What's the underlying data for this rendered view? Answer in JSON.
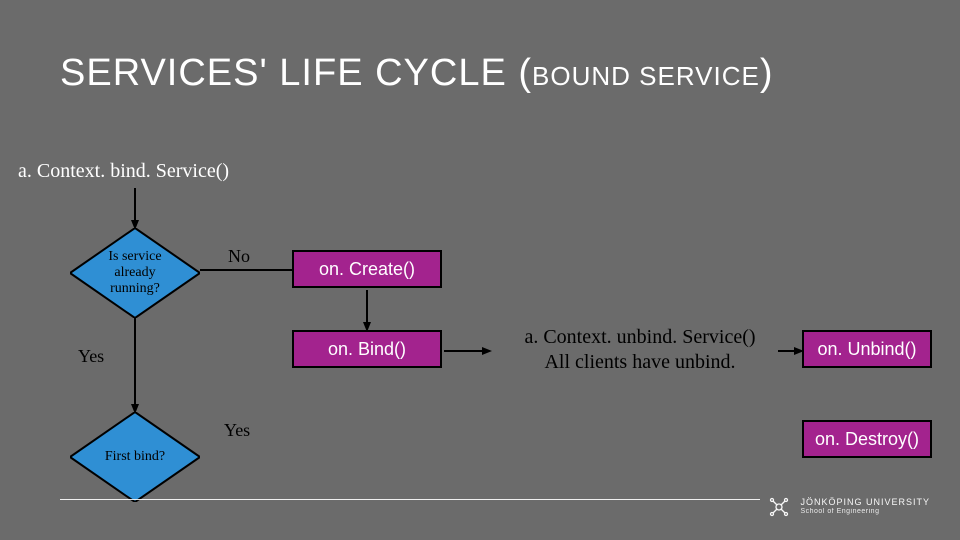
{
  "title_main": "SERVICES' LIFE CYCLE ",
  "title_paren_open": "(",
  "title_sub": "BOUND SERVICE",
  "title_paren_close": ")",
  "entry_call": "a. Context. bind. Service()",
  "decision1": "Is service already running?",
  "decision2": "First bind?",
  "labels": {
    "no": "No",
    "yes1": "Yes",
    "yes2": "Yes"
  },
  "procs": {
    "onCreate": "on. Create()",
    "onBind": "on. Bind()",
    "onUnbind": "on. Unbind()",
    "onDestroy": "on. Destroy()"
  },
  "midtext_line1": "a. Context. unbind. Service()",
  "midtext_line2": "All clients have unbind.",
  "logo": {
    "name": "JÖNKÖPING UNIVERSITY",
    "school": "School of Engineering"
  }
}
